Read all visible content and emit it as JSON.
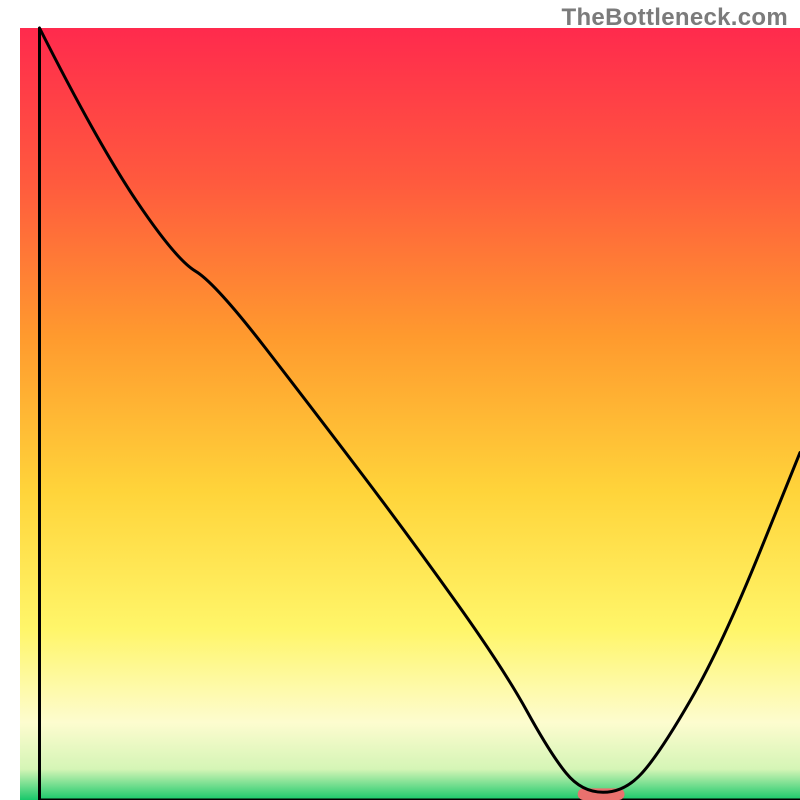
{
  "watermark": "TheBottleneck.com",
  "chart_data": {
    "type": "line",
    "title": "",
    "xlabel": "",
    "ylabel": "",
    "xlim": [
      0,
      100
    ],
    "ylim": [
      0,
      100
    ],
    "grid": false,
    "legend": false,
    "gradient_stops": [
      {
        "offset": 0.0,
        "color": "#ff2a4d"
      },
      {
        "offset": 0.2,
        "color": "#ff5a3e"
      },
      {
        "offset": 0.4,
        "color": "#ff9a2e"
      },
      {
        "offset": 0.6,
        "color": "#ffd43a"
      },
      {
        "offset": 0.78,
        "color": "#fff66a"
      },
      {
        "offset": 0.9,
        "color": "#fdfccf"
      },
      {
        "offset": 0.96,
        "color": "#d5f5b6"
      },
      {
        "offset": 1.0,
        "color": "#18c86a"
      }
    ],
    "series": [
      {
        "name": "bottleneck-curve",
        "color": "#000000",
        "x": [
          2.5,
          10,
          20,
          25,
          38,
          50,
          62,
          68,
          72,
          77.5,
          82,
          90,
          100
        ],
        "y": [
          100,
          85,
          70,
          67,
          50,
          34,
          17,
          6,
          1,
          1,
          6,
          20,
          45
        ]
      }
    ],
    "marker": {
      "name": "highlight-segment",
      "x_center": 74.5,
      "y": 0.75,
      "width": 6,
      "height": 1.5,
      "color": "#e9716e"
    },
    "axes": {
      "left": {
        "x": 2.5,
        "y1": 3.5,
        "y2": 100
      },
      "bottom": {
        "y": 100,
        "x1": 2.5,
        "x2": 100
      }
    }
  }
}
